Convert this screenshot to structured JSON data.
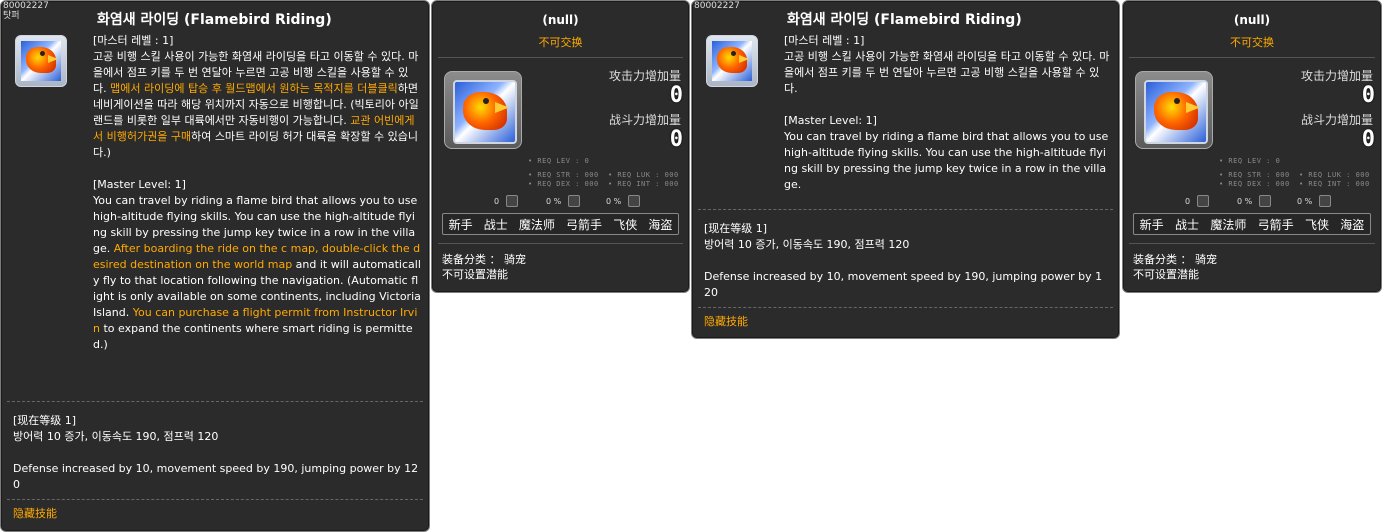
{
  "skill_tooltip": {
    "id_text": "80002227",
    "sub_label": "탓퍼",
    "title": "화염새 라이딩 (Flamebird Riding)",
    "ko_master_level": "[마스터 레벨 : 1]",
    "ko_desc_1": "고공 비행 스킬 사용이 가능한 화염새 라이딩을 타고 이동할 수 있다. 마을에서 점프 키를 두 번 연달아 누르면 고공 비행 스킬을 사용할 수 있다.",
    "ko_desc_orange_1": "맵에서 라이딩에 탑승 후 월드맵에서 원하는 목적지를 더블클릭",
    "ko_desc_2": "하면 네비게이션을 따라 해당 위치까지 자동으로 비행합니다. (빅토리아 아일랜드를 비롯한 일부 대륙에서만 자동비행이 가능합니다. ",
    "ko_desc_orange_2": "교관 어빈에게서 비행허가권을 구매",
    "ko_desc_3": "하여 스마트 라이딩 허가 대륙을 확장할 수 있습니다.)",
    "en_master_level": "[Master Level: 1]",
    "en_desc_1": "You can travel by riding a flame bird that allows you to use high-altitude flying skills. You can use the high-altitude flying skill by pressing the jump key twice in a row in the village.",
    "en_desc_orange_1": "After boarding the ride on the c map, double-click the desired destination on the world map",
    "en_desc_2": " and it will automatically fly to that location following the navigation. (Automatic flight is only available on some continents, including Victoria Island. ",
    "en_desc_orange_2": "You can purchase a flight permit from Instructor Irvin",
    "en_desc_3": " to expand the continents where smart riding is permitted.)",
    "current_level": "[现在等级 1]",
    "ko_effect": "방어력 10 증가, 이동속도 190, 점프력 120",
    "en_effect": "Defense increased by 10, movement speed by 190, jumping power by 120",
    "hidden_skill": "隐藏技能"
  },
  "skill_tooltip_short": {
    "id_text": "80002227",
    "title": "화염새 라이딩 (Flamebird Riding)",
    "ko_master_level": "[마스터 레벨 : 1]",
    "ko_desc": "고공 비행 스킬 사용이 가능한 화염새 라이딩을 타고 이동할 수 있다. 마을에서 점프 키를 두 번 연달아 누르면 고공 비행 스킬을 사용할 수 있다.",
    "en_master_level": "[Master Level: 1]",
    "en_desc": "You can travel by riding a flame bird that allows you to use high-altitude flying skills. You can use the high-altitude flying skill by pressing the jump key twice in a row in the village.",
    "current_level": "[现在等级 1]",
    "ko_effect": "방어력 10 증가, 이동속도 190, 점프력 120",
    "en_effect": "Defense increased by 10, movement speed by 190, jumping power by 120",
    "hidden_skill": "隐藏技能"
  },
  "item_tooltip": {
    "title": "(null)",
    "untradeable": "不可交换",
    "attack_label": "攻击力增加量",
    "attack_value": "0",
    "combat_label": "战斗力增加量",
    "combat_value": "0",
    "req_lev": "• REQ LEV :    0",
    "req_str": "• REQ STR : 000",
    "req_luk": "• REQ LUK : 000",
    "req_dex": "• REQ DEX : 000",
    "req_int": "• REQ INT : 000",
    "mini1": "0",
    "mini2": "0 %",
    "mini3": "0 %",
    "jobs": [
      "新手",
      "战士",
      "魔法师",
      "弓箭手",
      "飞侠",
      "海盗"
    ],
    "equip_category": "装备分类 ： 骑宠",
    "no_potential": "不可设置潜能"
  },
  "colors": {
    "panel_bg": "#2b2b2b",
    "accent_orange": "#ffaa00"
  }
}
